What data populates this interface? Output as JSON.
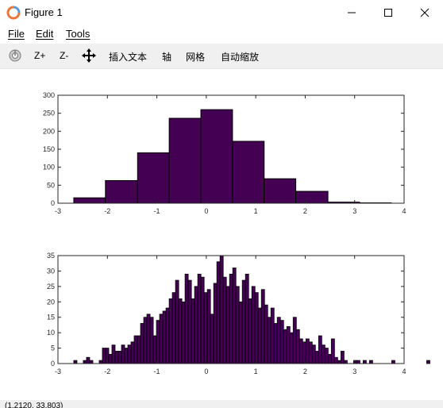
{
  "window": {
    "title": "Figure 1",
    "icon": "octave-logo-icon"
  },
  "menu": {
    "items": [
      "File",
      "Edit",
      "Tools"
    ]
  },
  "toolbar": {
    "home_icon": "reset-view-icon",
    "zoom_in": "Z+",
    "zoom_out": "Z-",
    "pan_icon": "pan-move-icon",
    "insert_text": "插入文本",
    "axis": "轴",
    "grid": "网格",
    "autoscale": "自动缩放"
  },
  "status": {
    "coords": "(1.2120, 33.803)"
  },
  "colors": {
    "bar_fill": "#440154",
    "bar_edge": "#000000"
  },
  "chart_data": [
    {
      "type": "bar",
      "title": "",
      "xlabel": "",
      "ylabel": "",
      "xlim": [
        -3,
        4
      ],
      "ylim": [
        0,
        300
      ],
      "xticks": [
        -3,
        -2,
        -1,
        0,
        1,
        2,
        3,
        4
      ],
      "yticks": [
        0,
        50,
        100,
        150,
        200,
        250,
        300
      ],
      "bin_edges": [
        -2.68,
        -2.04,
        -1.39,
        -0.75,
        -0.11,
        0.53,
        1.17,
        1.81,
        2.46,
        3.1,
        3.74
      ],
      "values": [
        15,
        63,
        140,
        236,
        260,
        172,
        68,
        33,
        3,
        1
      ]
    },
    {
      "type": "bar",
      "title": "",
      "xlabel": "",
      "ylabel": "",
      "xlim": [
        -3,
        4
      ],
      "ylim": [
        0,
        35
      ],
      "xticks": [
        -3,
        -2,
        -1,
        0,
        1,
        2,
        3,
        4
      ],
      "yticks": [
        0,
        5,
        10,
        15,
        20,
        25,
        30,
        35
      ],
      "bin_start": -2.68,
      "bin_width": 0.0643,
      "values": [
        1,
        0,
        0,
        1,
        2,
        1,
        0,
        0,
        1,
        5,
        5,
        3,
        6,
        4,
        4,
        6,
        5,
        6,
        7,
        9,
        9,
        13,
        15,
        16,
        15,
        9,
        14,
        16,
        17,
        18,
        21,
        23,
        27,
        21,
        20,
        29,
        27,
        21,
        25,
        29,
        28,
        23,
        24,
        16,
        26,
        33,
        35,
        28,
        25,
        29,
        31,
        25,
        20,
        27,
        29,
        21,
        25,
        23,
        18,
        24,
        19,
        15,
        18,
        13,
        15,
        14,
        11,
        12,
        10,
        15,
        11,
        8,
        7,
        8,
        7,
        6,
        4,
        9,
        6,
        5,
        3,
        8,
        2,
        1,
        4,
        1,
        0,
        0,
        1,
        1,
        0,
        1,
        0,
        1,
        0,
        0,
        0,
        0,
        0,
        0,
        1,
        0,
        0,
        0,
        0,
        0,
        0,
        0,
        0,
        0,
        0,
        1,
        0,
        0
      ]
    }
  ]
}
